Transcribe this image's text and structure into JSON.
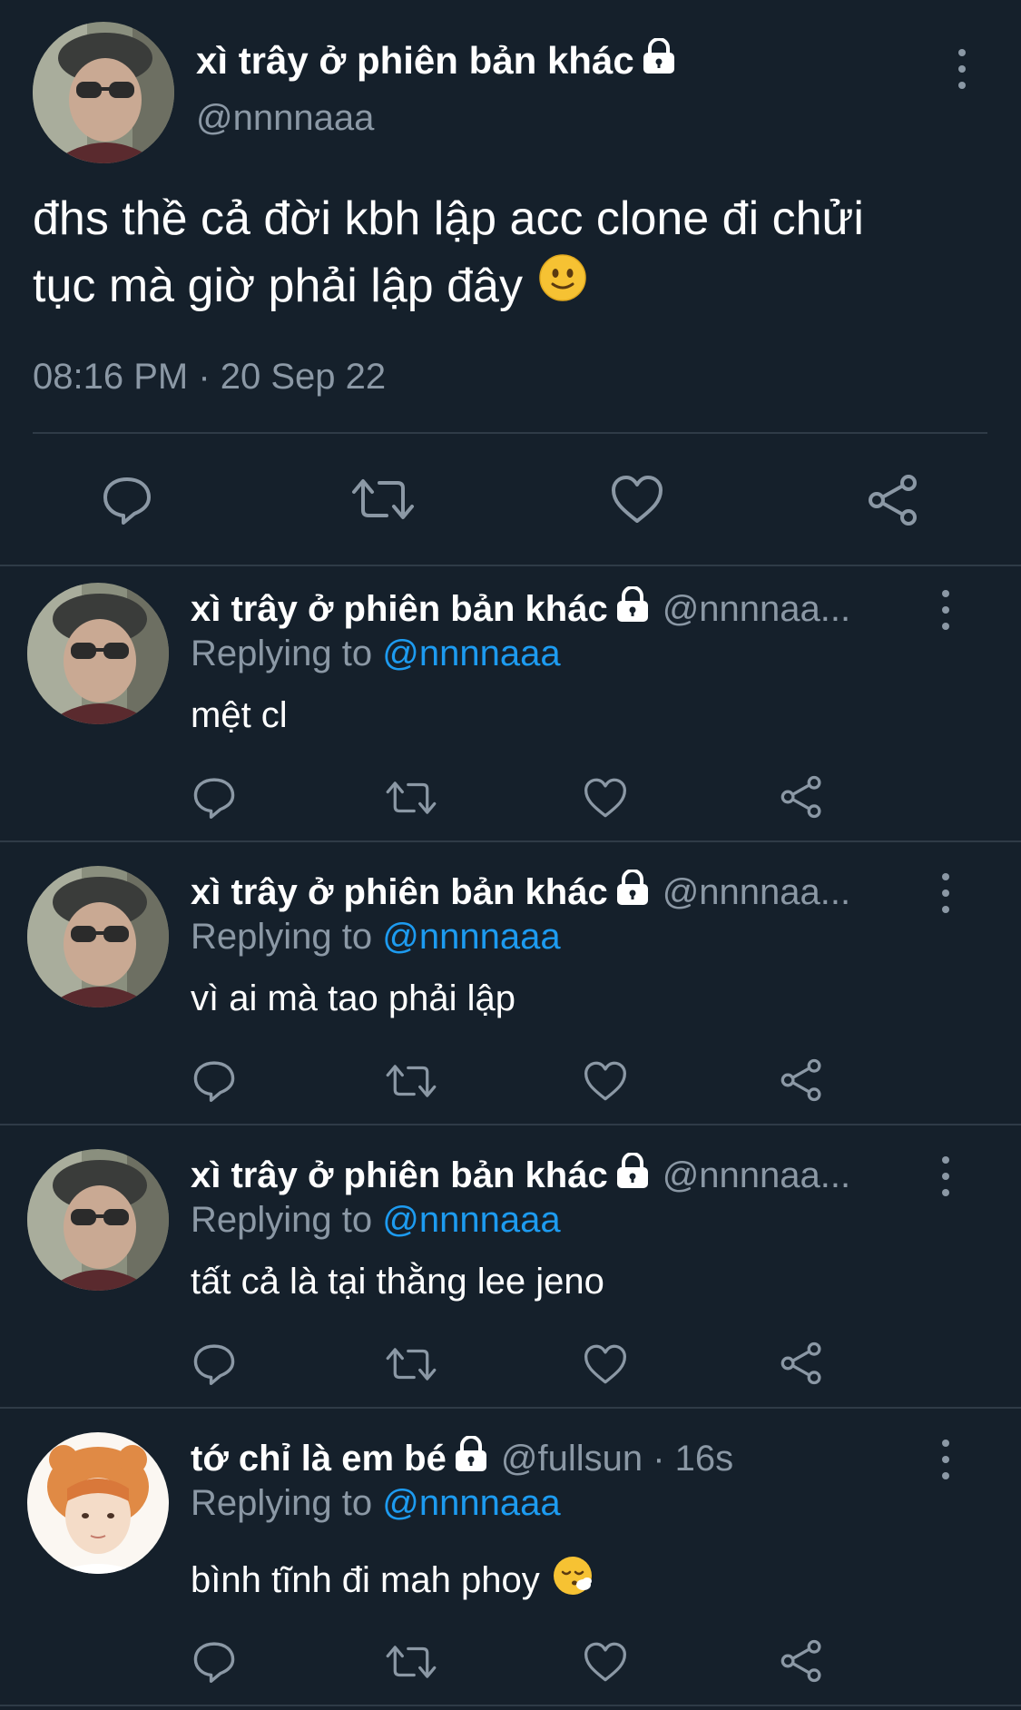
{
  "main_tweet": {
    "display_name": "xì trây ở phiên bản khác",
    "handle": "@nnnnaaa",
    "text_line1": "đhs thề cả đời kbh lập acc clone đi chửi",
    "text_line2": "tục mà giờ phải lập đây",
    "timestamp": "08:16 PM · 20 Sep 22"
  },
  "replies": [
    {
      "display_name": "xì trây ở phiên bản khác",
      "handle": "@nnnnaa...",
      "replying_prefix": "Replying to ",
      "replying_to": "@nnnnaaa",
      "text": "mệt cl"
    },
    {
      "display_name": "xì trây ở phiên bản khác",
      "handle": "@nnnnaa...",
      "replying_prefix": "Replying to ",
      "replying_to": "@nnnnaaa",
      "text": "vì ai mà tao phải lập"
    },
    {
      "display_name": "xì trây ở phiên bản khác",
      "handle": "@nnnnaa...",
      "replying_prefix": "Replying to ",
      "replying_to": "@nnnnaaa",
      "text": "tất cả là tại thằng lee jeno"
    },
    {
      "display_name": "tớ chỉ là em bé",
      "handle": "@fullsun · 16s",
      "replying_prefix": "Replying to ",
      "replying_to": "@nnnnaaa",
      "text": "bình tĩnh đi mah phoy"
    }
  ],
  "icons": {
    "reply": "reply-icon",
    "retweet": "retweet-icon",
    "like": "heart-icon",
    "share": "share-icon",
    "protected": "lock-icon",
    "more": "more-options-icon"
  },
  "colors": {
    "background": "#15202b",
    "text": "#ffffff",
    "secondary": "#8b98a5",
    "mention": "#1d9bf0",
    "divider": "#2f3b47"
  }
}
